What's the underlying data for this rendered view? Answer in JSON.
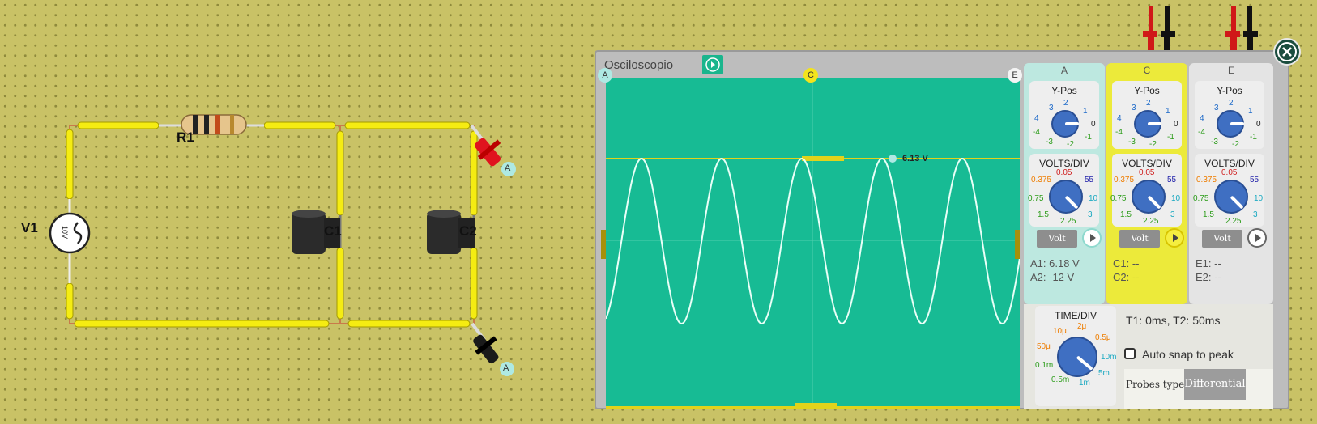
{
  "circuit": {
    "v1_label": "V1",
    "v1_value": "10V",
    "r1_label": "R1",
    "c1_label": "C1",
    "c2_label": "C2",
    "probe_a_top": "A",
    "probe_a_bottom": "A"
  },
  "scope": {
    "title": "Osciloscopio",
    "markers": {
      "a": "A",
      "c": "C",
      "e": "E"
    },
    "cursor_label": "6.13 V",
    "channels": [
      {
        "id": "A",
        "ypos_title": "Y-Pos",
        "volts_title": "VOLTS/DIV",
        "volt_btn": "Volt",
        "line1": "A1: 6.18 V",
        "line2": "A2: -12 V"
      },
      {
        "id": "C",
        "ypos_title": "Y-Pos",
        "volts_title": "VOLTS/DIV",
        "volt_btn": "Volt",
        "line1": "C1: --",
        "line2": "C2: --"
      },
      {
        "id": "E",
        "ypos_title": "Y-Pos",
        "volts_title": "VOLTS/DIV",
        "volt_btn": "Volt",
        "line1": "E1: --",
        "line2": "E2: --"
      }
    ],
    "ypos_ticks": [
      "3",
      "2",
      "1",
      "4",
      "0",
      "-4",
      "-1",
      "-3",
      "-2"
    ],
    "volts_ticks": [
      "0.05",
      "0.375",
      "55",
      "0.75",
      "10",
      "1.5",
      "3",
      "2.25"
    ],
    "time": {
      "title": "TIME/DIV",
      "ticks": [
        "2μ",
        "10μ",
        "0.5μ",
        "50μ",
        "10m",
        "0.1m",
        "5m",
        "0.5m",
        "1m"
      ],
      "t_readout": "T1: 0ms, T2: 50ms",
      "auto_snap_label": "Auto snap to peak",
      "probes_type_label": "Probes type",
      "probes_type_value": "Differential"
    },
    "colors": {
      "screen": "#17bb94",
      "trace": "#e9fff7",
      "cursor": "#e2d31b",
      "panel_a": "#bde8e0",
      "panel_c": "#ecea3a",
      "panel_e": "#e4e4e4"
    }
  }
}
